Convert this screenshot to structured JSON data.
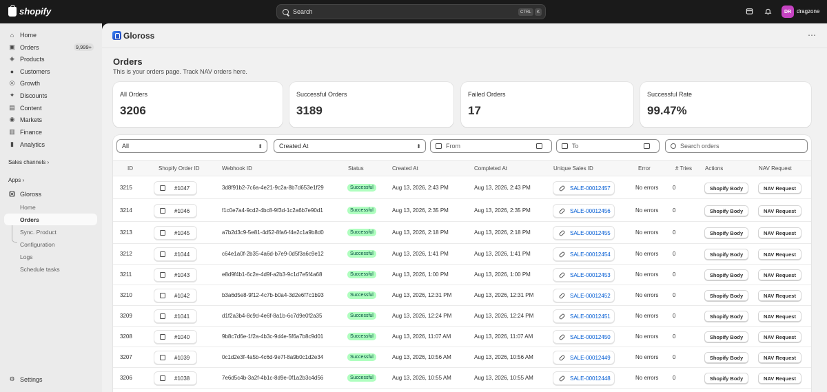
{
  "topbar": {
    "brand": "shopify",
    "search_placeholder": "Search",
    "kbd_ctrl": "CTRL",
    "kbd_k": "K",
    "avatar_initials": "DR",
    "store_name": "dragzone"
  },
  "sidebar": {
    "items": [
      {
        "label": "Home",
        "icon": "home-icon",
        "glyph": "⌂"
      },
      {
        "label": "Orders",
        "icon": "orders-icon",
        "glyph": "▣",
        "count": "9,999+"
      },
      {
        "label": "Products",
        "icon": "products-icon",
        "glyph": "◈"
      },
      {
        "label": "Customers",
        "icon": "customers-icon",
        "glyph": "●"
      },
      {
        "label": "Growth",
        "icon": "growth-icon",
        "glyph": "◎"
      },
      {
        "label": "Discounts",
        "icon": "discounts-icon",
        "glyph": "✦"
      },
      {
        "label": "Content",
        "icon": "content-icon",
        "glyph": "▤"
      },
      {
        "label": "Markets",
        "icon": "markets-icon",
        "glyph": "◉"
      },
      {
        "label": "Finance",
        "icon": "finance-icon",
        "glyph": "▥"
      },
      {
        "label": "Analytics",
        "icon": "analytics-icon",
        "glyph": "▮"
      }
    ],
    "sales_channels": "Sales channels",
    "apps": "Apps",
    "app_name": "Gloross",
    "app_sub": [
      "Home",
      "Orders",
      "Sync. Product",
      "Configuration",
      "Logs",
      "Schedule tasks"
    ],
    "settings": "Settings"
  },
  "app": {
    "name": "Gloross",
    "title": "Orders",
    "subtitle": "This is your orders page. Track NAV orders here."
  },
  "stats": [
    {
      "label": "All Orders",
      "value": "3206"
    },
    {
      "label": "Successful Orders",
      "value": "3189"
    },
    {
      "label": "Failed Orders",
      "value": "17"
    },
    {
      "label": "Successful Rate",
      "value": "99.47%"
    }
  ],
  "filters": {
    "status": "All",
    "sort": "Created At",
    "from": "From",
    "to": "To",
    "search_placeholder": "Search orders"
  },
  "table": {
    "headers": [
      "ID",
      "Shopify Order ID",
      "Webhook ID",
      "Status",
      "Created At",
      "Completed At",
      "Unique Sales ID",
      "Error",
      "# Tries",
      "Actions",
      "NAV Request"
    ],
    "action_label": "Shopify Body",
    "nav_label": "NAV Request",
    "rows": [
      {
        "id": "3215",
        "order": "#1047",
        "webhook": "3d8f91b2-7c6a-4e21-9c2a-8b7d653e1f29",
        "status": "Successful",
        "created": "Aug 13, 2026, 2:43 PM",
        "completed": "Aug 13, 2026, 2:43 PM",
        "sale": "SALE-00012457",
        "error": "No errors",
        "tries": "0"
      },
      {
        "id": "3214",
        "order": "#1046",
        "webhook": "f1c0e7a4-9cd2-4bc8-9f3d-1c2a6b7e90d1",
        "status": "Successful",
        "created": "Aug 13, 2026, 2:35 PM",
        "completed": "Aug 13, 2026, 2:35 PM",
        "sale": "SALE-00012456",
        "error": "No errors",
        "tries": "0"
      },
      {
        "id": "3213",
        "order": "#1045",
        "webhook": "a7b2d3c9-5e81-4d52-8fa6-f4e2c1a9b8d0",
        "status": "Successful",
        "created": "Aug 13, 2026, 2:18 PM",
        "completed": "Aug 13, 2026, 2:18 PM",
        "sale": "SALE-00012455",
        "error": "No errors",
        "tries": "0"
      },
      {
        "id": "3212",
        "order": "#1044",
        "webhook": "c64e1a0f-2b35-4a6d-b7e9-0d5f3a6c9e12",
        "status": "Successful",
        "created": "Aug 13, 2026, 1:41 PM",
        "completed": "Aug 13, 2026, 1:41 PM",
        "sale": "SALE-00012454",
        "error": "No errors",
        "tries": "0"
      },
      {
        "id": "3211",
        "order": "#1043",
        "webhook": "e8d9f4b1-6c2e-4d9f-a2b3-9c1d7e5f4a68",
        "status": "Successful",
        "created": "Aug 13, 2026, 1:00 PM",
        "completed": "Aug 13, 2026, 1:00 PM",
        "sale": "SALE-00012453",
        "error": "No errors",
        "tries": "0"
      },
      {
        "id": "3210",
        "order": "#1042",
        "webhook": "b3a6d5e8-9f12-4c7b-b0a4-3d2e6f7c1b93",
        "status": "Successful",
        "created": "Aug 13, 2026, 12:31 PM",
        "completed": "Aug 13, 2026, 12:31 PM",
        "sale": "SALE-00012452",
        "error": "No errors",
        "tries": "0"
      },
      {
        "id": "3209",
        "order": "#1041",
        "webhook": "d1f2a3b4-8c9d-4e6f-8a1b-6c7d9e0f2a35",
        "status": "Successful",
        "created": "Aug 13, 2026, 12:24 PM",
        "completed": "Aug 13, 2026, 12:24 PM",
        "sale": "SALE-00012451",
        "error": "No errors",
        "tries": "0"
      },
      {
        "id": "3208",
        "order": "#1040",
        "webhook": "9b8c7d6e-1f2a-4b3c-9d4e-5f6a7b8c9d01",
        "status": "Successful",
        "created": "Aug 13, 2026, 11:07 AM",
        "completed": "Aug 13, 2026, 11:07 AM",
        "sale": "SALE-00012450",
        "error": "No errors",
        "tries": "0"
      },
      {
        "id": "3207",
        "order": "#1039",
        "webhook": "0c1d2e3f-4a5b-4c6d-9e7f-8a9b0c1d2e34",
        "status": "Successful",
        "created": "Aug 13, 2026, 10:56 AM",
        "completed": "Aug 13, 2026, 10:56 AM",
        "sale": "SALE-00012449",
        "error": "No errors",
        "tries": "0"
      },
      {
        "id": "3206",
        "order": "#1038",
        "webhook": "7e6d5c4b-3a2f-4b1c-8d9e-0f1a2b3c4d56",
        "status": "Successful",
        "created": "Aug 13, 2026, 10:55 AM",
        "completed": "Aug 13, 2026, 10:55 AM",
        "sale": "SALE-00012448",
        "error": "No errors",
        "tries": "0"
      }
    ]
  }
}
